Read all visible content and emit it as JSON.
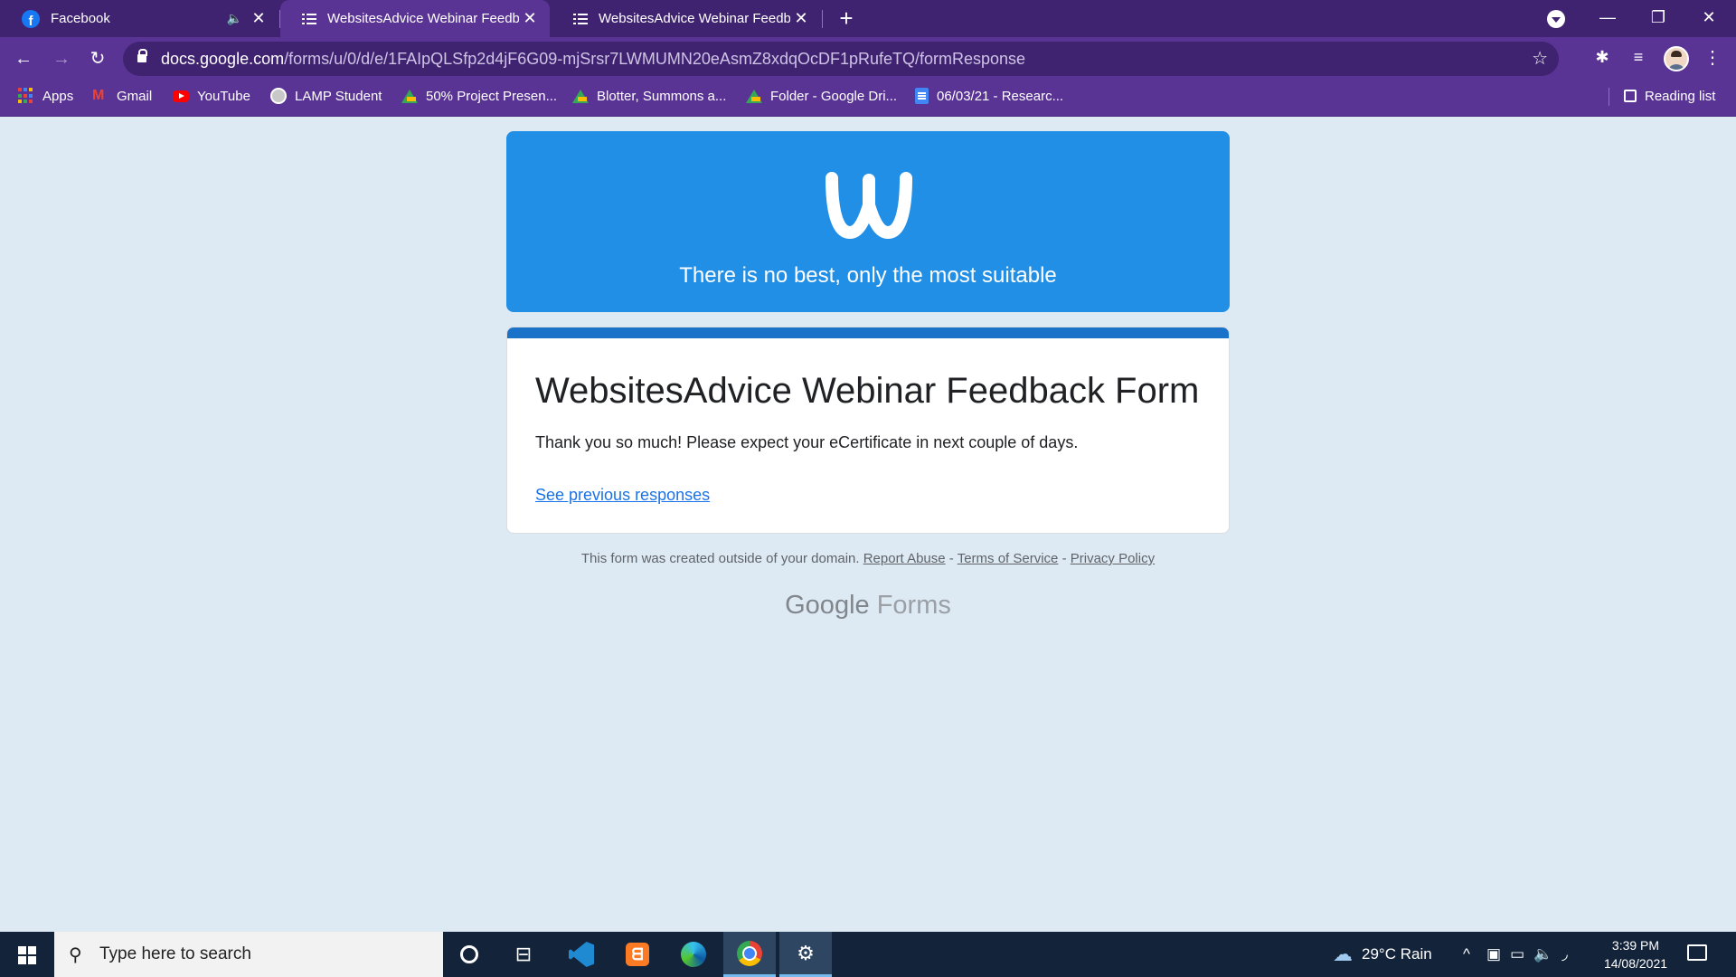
{
  "browser": {
    "tabs": [
      {
        "title": "Facebook"
      },
      {
        "title": "WebsitesAdvice Webinar Feedback Form"
      },
      {
        "title": "WebsitesAdvice Webinar Feedback Form"
      }
    ],
    "url_host": "docs.google.com",
    "url_path": "/forms/u/0/d/e/1FAIpQLSfp2d4jF6G09-mjSrsr7LWMUMN20eAsmZ8xdqOcDF1pRufeTQ/formResponse",
    "bookmarks": [
      {
        "label": "Apps"
      },
      {
        "label": "Gmail"
      },
      {
        "label": "YouTube"
      },
      {
        "label": "LAMP Student"
      },
      {
        "label": "50% Project Presen..."
      },
      {
        "label": "Blotter, Summons a..."
      },
      {
        "label": "Folder - Google Dri..."
      },
      {
        "label": "06/03/21 - Researc..."
      }
    ],
    "reading_list": "Reading list"
  },
  "banner": {
    "tagline": "There is no best, only the most suitable"
  },
  "form": {
    "title": "WebsitesAdvice Webinar Feedback Form",
    "confirmation": "Thank you so much! Please expect your eCertificate in next couple of days.",
    "previous_link": "See previous responses"
  },
  "footer": {
    "note": "This form was created outside of your domain.",
    "report_abuse": "Report Abuse",
    "sep": "-",
    "terms": "Terms of Service",
    "privacy": "Privacy Policy",
    "brand_google": "Google",
    "brand_forms": "Forms"
  },
  "taskbar": {
    "search_placeholder": "Type here to search",
    "weather": "29°C  Rain",
    "time": "3:39 PM",
    "date": "14/08/2021"
  },
  "colors": {
    "tabstrip": "#3f2370",
    "toolbar": "#5a3495",
    "banner": "#218fe6",
    "accent": "#1a73c8",
    "link": "#1a73e8",
    "page_bg": "#ddeaf4"
  }
}
